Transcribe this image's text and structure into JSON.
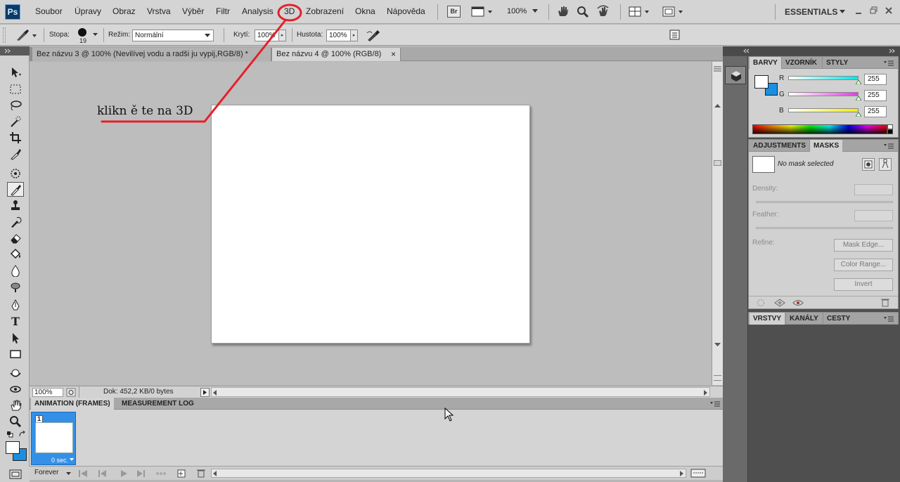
{
  "menubar": {
    "app_logo": "Ps",
    "items": [
      "Soubor",
      "Úpravy",
      "Obraz",
      "Vrstva",
      "Výběr",
      "Filtr",
      "Analysis",
      "3D",
      "Zobrazení",
      "Okna",
      "Nápověda"
    ],
    "bridge_label": "Br",
    "zoom": "100%",
    "workspace": "ESSENTIALS"
  },
  "options_bar": {
    "brush_label": "Stopa:",
    "brush_size": "19",
    "mode_label": "Režim:",
    "mode_value": "Normální",
    "opacity_label": "Krytí:",
    "opacity_value": "100%",
    "flow_label": "Hustota:",
    "flow_value": "100%"
  },
  "documents": {
    "tabs": [
      {
        "title": "Bez názvu 3 @ 100% (Nevilívej vodu a radši ju vypij,RGB/8) *",
        "active": false
      },
      {
        "title": "Bez názvu 4 @ 100% (RGB/8)",
        "active": true
      }
    ],
    "close_glyph": "×"
  },
  "annotation": {
    "text": "klikn ě te na 3D",
    "color": "#e5202a"
  },
  "status_bar": {
    "zoom": "100%",
    "doc_info": "Dok: 452,2 KB/0 bytes"
  },
  "animation_panel": {
    "tabs": [
      "ANIMATION (FRAMES)",
      "MEASUREMENT LOG"
    ],
    "frame_number": "1",
    "frame_delay": "0 sec.",
    "loop_option": "Forever"
  },
  "color_panel": {
    "tabs": [
      "BARVY",
      "VZORNÍK",
      "STYLY"
    ],
    "channels": [
      {
        "label": "R",
        "value": "255",
        "color": "#00e5e5"
      },
      {
        "label": "G",
        "value": "255",
        "color": "#e53ae5"
      },
      {
        "label": "B",
        "value": "255",
        "color": "#f0f000"
      }
    ]
  },
  "masks_panel": {
    "tabs": [
      "ADJUSTMENTS",
      "MASKS"
    ],
    "status": "No mask selected",
    "density_label": "Density:",
    "feather_label": "Feather:",
    "refine_label": "Refine:",
    "buttons": [
      "Mask Edge...",
      "Color Range...",
      "Invert"
    ]
  },
  "layers_panel": {
    "tabs": [
      "VRSTVY",
      "KANÁLY",
      "CESTY"
    ]
  }
}
